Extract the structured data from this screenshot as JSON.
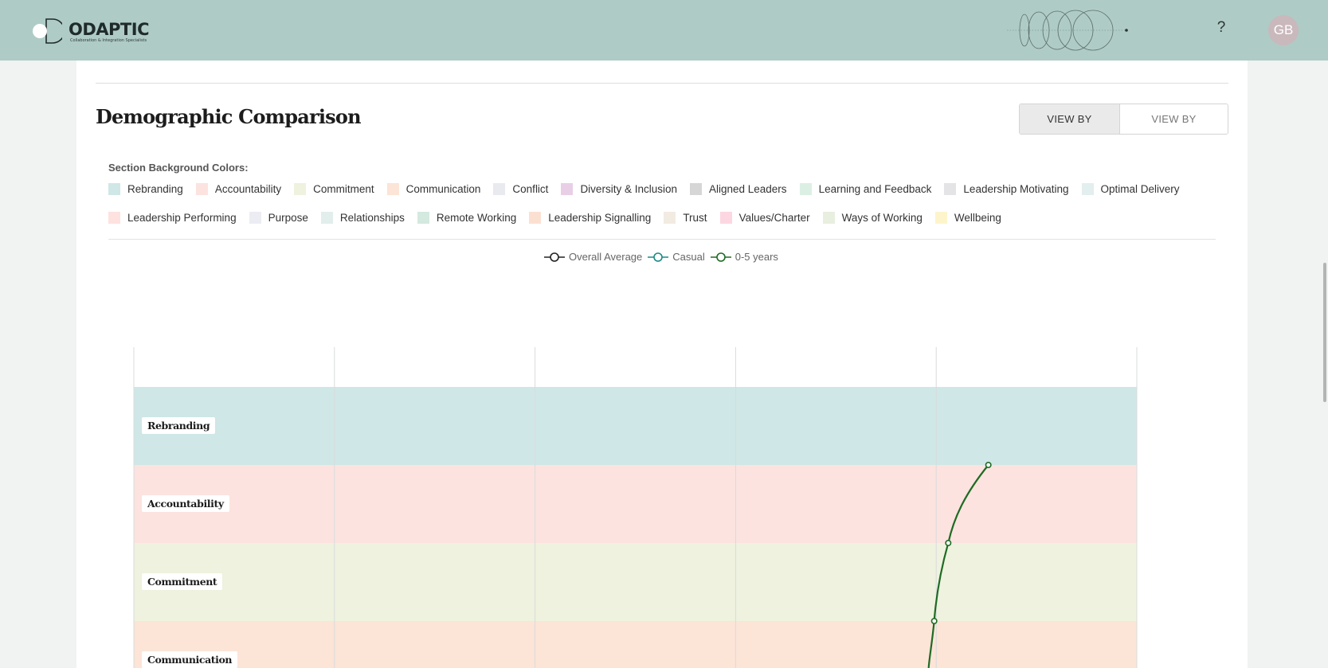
{
  "header": {
    "logo_name": "ODAPTIC",
    "logo_tagline": "Collaboration & Integration Specialists",
    "help_label": "?",
    "avatar_initials": "GB",
    "brand_color": "#afcbc5"
  },
  "page": {
    "title": "Demographic Comparison",
    "view_toggle": {
      "by_section": "VIEW BY SECTION",
      "by_question": "VIEW BY QUESTION",
      "active": "by_section"
    }
  },
  "section_legend": {
    "title": "Section Background Colors:",
    "row1": [
      {
        "label": "Rebranding",
        "color": "#cfe7e6"
      },
      {
        "label": "Accountability",
        "color": "#fce3df"
      },
      {
        "label": "Commitment",
        "color": "#eef2de"
      },
      {
        "label": "Communication",
        "color": "#fce4d7"
      },
      {
        "label": "Conflict",
        "color": "#e9e9f0"
      },
      {
        "label": "Diversity & Inclusion",
        "color": "#e8cfe6"
      },
      {
        "label": "Aligned Leaders",
        "color": "#d6d6d6"
      },
      {
        "label": "Learning and Feedback",
        "color": "#dcefe4"
      },
      {
        "label": "Leadership Motivating",
        "color": "#e4e4e6"
      },
      {
        "label": "Optimal Delivery",
        "color": "#e3eeee"
      }
    ],
    "row2": [
      {
        "label": "Leadership Performing",
        "color": "#fde2e0"
      },
      {
        "label": "Purpose",
        "color": "#ececf3"
      },
      {
        "label": "Relationships",
        "color": "#e2eeec"
      },
      {
        "label": "Remote Working",
        "color": "#d4e9df"
      },
      {
        "label": "Leadership Signalling",
        "color": "#fbe0d2"
      },
      {
        "label": "Trust",
        "color": "#f2ebe2"
      },
      {
        "label": "Values/Charter",
        "color": "#fcd7e2"
      },
      {
        "label": "Ways of Working",
        "color": "#e8efdf"
      },
      {
        "label": "Wellbeing",
        "color": "#fdf4cc"
      }
    ]
  },
  "chart_data": {
    "type": "line",
    "orientation": "vertical-categories",
    "series": [
      {
        "name": "Overall Average",
        "color": "#222222"
      },
      {
        "name": "Casual",
        "color": "#1b8a86"
      },
      {
        "name": "0-5 years",
        "color": "#1e6b24",
        "points": [
          {
            "section": "Rebranding",
            "value": 4.26
          },
          {
            "section": "Accountability",
            "value": 4.06
          },
          {
            "section": "Commitment",
            "value": 3.99
          }
        ]
      }
    ],
    "categories": [
      "Rebranding",
      "Accountability",
      "Commitment",
      "Communication"
    ],
    "xlim": [
      0,
      5
    ],
    "grid": true
  }
}
